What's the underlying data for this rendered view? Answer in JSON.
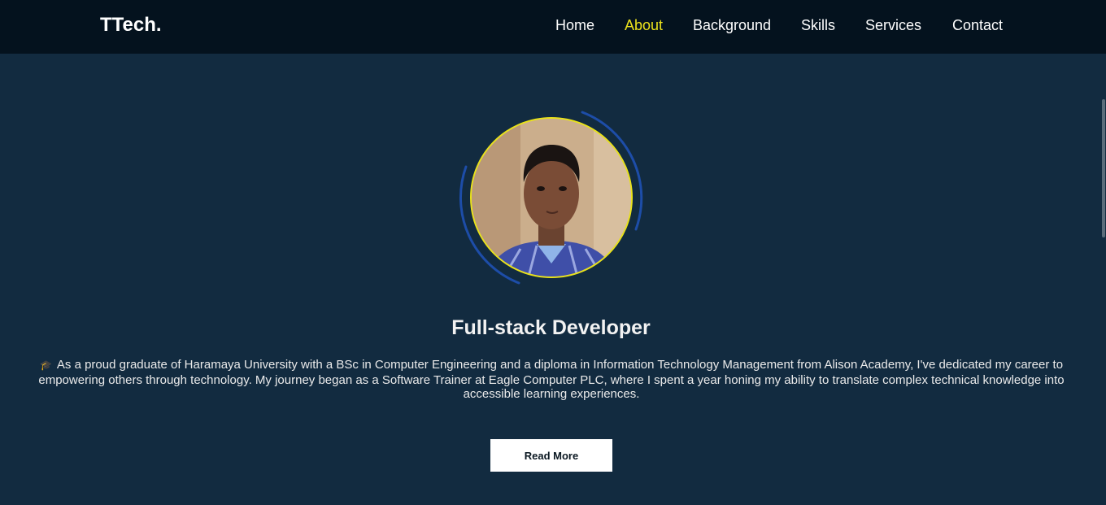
{
  "brand": {
    "logo_text": "TTech."
  },
  "nav": {
    "items": [
      {
        "label": "Home"
      },
      {
        "label": "About"
      },
      {
        "label": "Background"
      },
      {
        "label": "Skills"
      },
      {
        "label": "Services"
      },
      {
        "label": "Contact"
      }
    ],
    "active_item": "About"
  },
  "profile": {
    "photo": "profile-photo",
    "role_title": "Full-stack Developer",
    "bio_icon": "🎓",
    "bio_text": "As a proud graduate of Haramaya University with a BSc in Computer Engineering and a diploma in Information Technology Management from Alison Academy, I've dedicated my career to empowering others through technology. My journey began as a Software Trainer at Eagle Computer PLC, where I spent a year honing my ability to translate complex technical knowledge into accessible learning experiences."
  },
  "actions": {
    "read_more_label": "Read More"
  },
  "colors": {
    "background": "#122b40",
    "navbar": "#04121e",
    "accent": "#ece21c",
    "arc": "#1d4da8"
  }
}
